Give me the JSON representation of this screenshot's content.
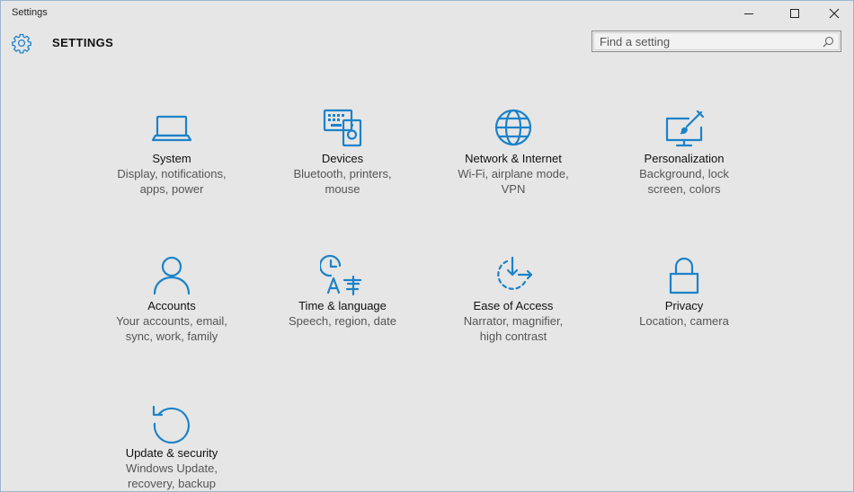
{
  "window": {
    "title": "Settings",
    "controls": [
      "minimize",
      "maximize",
      "close"
    ]
  },
  "header": {
    "title": "SETTINGS",
    "icon": "gear-icon",
    "search": {
      "placeholder": "Find a setting",
      "value": ""
    }
  },
  "accent_color": "#1c82c9",
  "background_color": "#e6e6e6",
  "tiles": [
    {
      "name": "System",
      "desc1": "Display, notifications,",
      "desc2": "apps, power",
      "icon": "laptop-icon"
    },
    {
      "name": "Devices",
      "desc1": "Bluetooth, printers,",
      "desc2": "mouse",
      "icon": "keyboard-speaker-icon"
    },
    {
      "name": "Network & Internet",
      "desc1": "Wi-Fi, airplane mode,",
      "desc2": "VPN",
      "icon": "globe-icon"
    },
    {
      "name": "Personalization",
      "desc1": "Background, lock",
      "desc2": "screen, colors",
      "icon": "monitor-brush-icon"
    },
    {
      "name": "Accounts",
      "desc1": "Your accounts, email,",
      "desc2": "sync, work, family",
      "icon": "person-icon"
    },
    {
      "name": "Time & language",
      "desc1": "Speech, region, date",
      "desc2": "",
      "icon": "clock-language-icon"
    },
    {
      "name": "Ease of Access",
      "desc1": "Narrator, magnifier,",
      "desc2": "high contrast",
      "icon": "ease-of-access-icon"
    },
    {
      "name": "Privacy",
      "desc1": "Location, camera",
      "desc2": "",
      "icon": "padlock-icon"
    },
    {
      "name": "Update & security",
      "desc1": "Windows Update,",
      "desc2": "recovery, backup",
      "icon": "refresh-icon"
    }
  ]
}
